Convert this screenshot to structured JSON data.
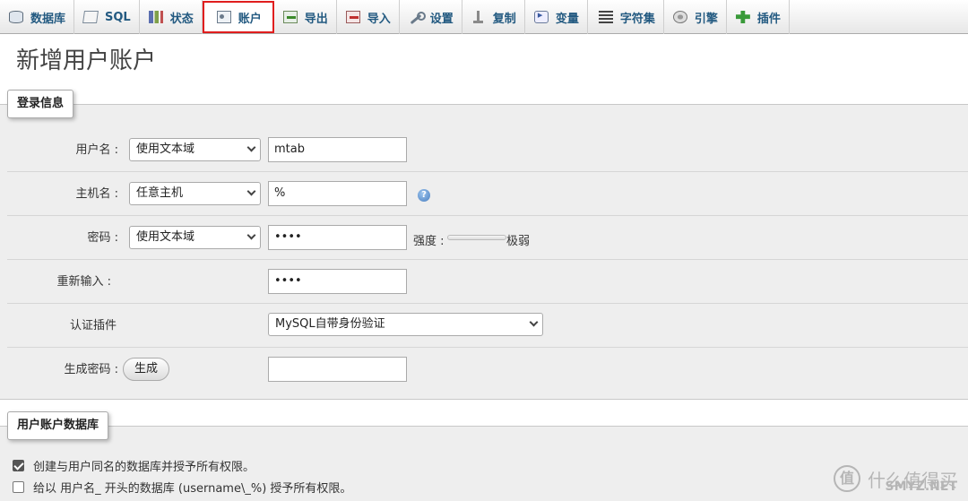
{
  "tabs": [
    {
      "key": "databases",
      "label": "数据库",
      "icon": "database-icon"
    },
    {
      "key": "sql",
      "label": "SQL",
      "icon": "sql-icon"
    },
    {
      "key": "status",
      "label": "状态",
      "icon": "status-chart-icon"
    },
    {
      "key": "accounts",
      "label": "账户",
      "icon": "user-accounts-icon",
      "active": true
    },
    {
      "key": "export",
      "label": "导出",
      "icon": "export-icon"
    },
    {
      "key": "import",
      "label": "导入",
      "icon": "import-icon"
    },
    {
      "key": "settings",
      "label": "设置",
      "icon": "wrench-icon"
    },
    {
      "key": "replication",
      "label": "复制",
      "icon": "replication-icon"
    },
    {
      "key": "variables",
      "label": "变量",
      "icon": "variables-icon"
    },
    {
      "key": "charset",
      "label": "字符集",
      "icon": "charset-icon"
    },
    {
      "key": "engines",
      "label": "引擎",
      "icon": "engines-icon"
    },
    {
      "key": "plugins",
      "label": "插件",
      "icon": "plugin-icon"
    }
  ],
  "page": {
    "title": "新增用户账户"
  },
  "login": {
    "legend": "登录信息",
    "username": {
      "label": "用户名 :",
      "mode": "使用文本域",
      "value": "mtab"
    },
    "host": {
      "label": "主机名 :",
      "mode": "任意主机",
      "value": "%"
    },
    "password": {
      "label": "密码 :",
      "mode": "使用文本域",
      "value": "••••",
      "strength_label": "强度 :",
      "strength_value": "极弱"
    },
    "retype": {
      "label": "重新输入 :",
      "value": "••••"
    },
    "auth_plugin": {
      "label": "认证插件",
      "value": "MySQL自带身份验证"
    },
    "generate": {
      "label": "生成密码 :",
      "button": "生成",
      "value": ""
    }
  },
  "database": {
    "legend": "用户账户数据库",
    "options": [
      {
        "label": "创建与用户同名的数据库并授予所有权限。",
        "checked": true
      },
      {
        "label": "给以 用户名_ 开头的数据库 (username\\_%) 授予所有权限。",
        "checked": false
      }
    ]
  },
  "watermark": {
    "glyph": "值",
    "text": "什么值得买",
    "sub": "SMYZ.NET"
  },
  "colors": {
    "accent": "#235a81",
    "highlight": "#e01e1e",
    "panel": "#eeeeee"
  }
}
